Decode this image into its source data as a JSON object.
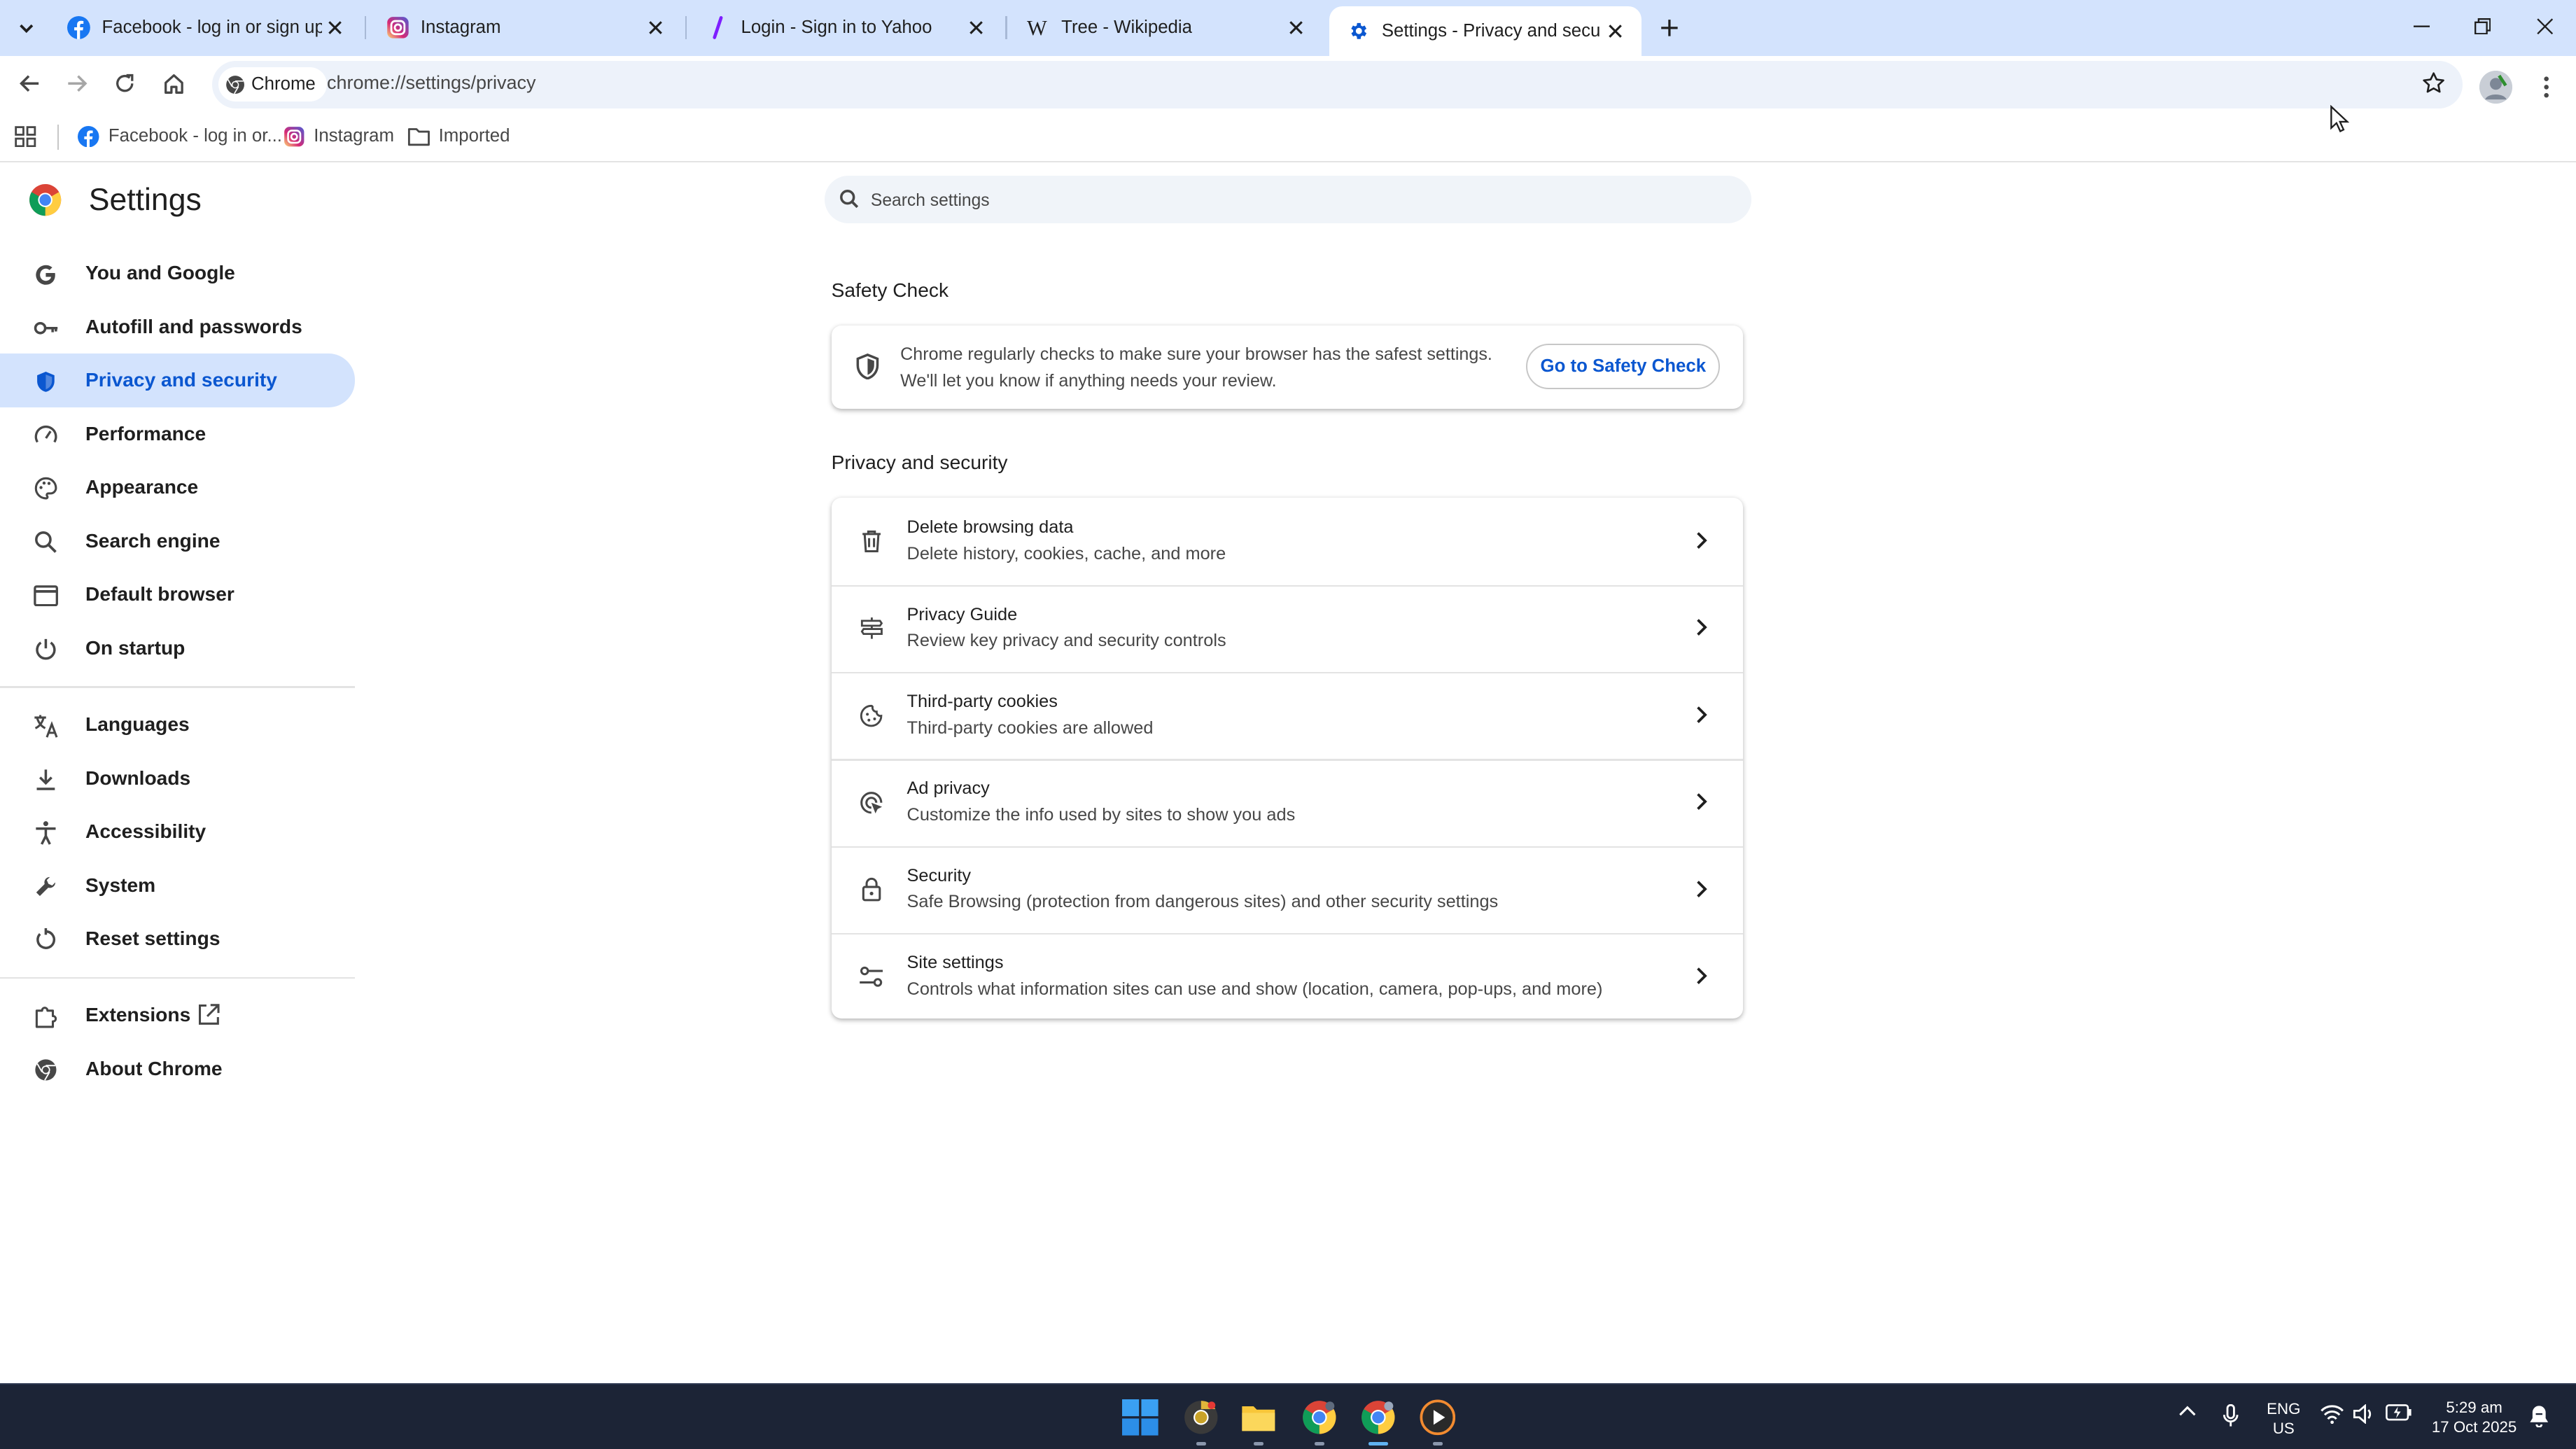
{
  "tabs": [
    {
      "title": "Facebook - log in or sign up",
      "icon": "facebook-icon",
      "active": false
    },
    {
      "title": "Instagram",
      "icon": "instagram-icon",
      "active": false
    },
    {
      "title": "Login - Sign in to Yahoo",
      "icon": "yahoo-icon",
      "active": false
    },
    {
      "title": "Tree - Wikipedia",
      "icon": "wikipedia-icon",
      "active": false
    },
    {
      "title": "Settings - Privacy and security",
      "icon": "settings-gear-icon",
      "active": true
    }
  ],
  "toolbar": {
    "chip_label": "Chrome",
    "url": "chrome://settings/privacy"
  },
  "bookmarks": [
    {
      "label": "Facebook - log in or...",
      "icon": "facebook-icon"
    },
    {
      "label": "Instagram",
      "icon": "instagram-icon"
    },
    {
      "label": "Imported",
      "icon": "folder-icon"
    }
  ],
  "settings": {
    "title": "Settings",
    "search_placeholder": "Search settings",
    "nav": [
      {
        "label": "You and Google",
        "icon": "google-icon"
      },
      {
        "label": "Autofill and passwords",
        "icon": "key-icon"
      },
      {
        "label": "Privacy and security",
        "icon": "shield-icon",
        "selected": true
      },
      {
        "label": "Performance",
        "icon": "speedometer-icon"
      },
      {
        "label": "Appearance",
        "icon": "palette-icon"
      },
      {
        "label": "Search engine",
        "icon": "search-icon"
      },
      {
        "label": "Default browser",
        "icon": "browser-window-icon"
      },
      {
        "label": "On startup",
        "icon": "power-icon"
      },
      {
        "label": "Languages",
        "icon": "translate-icon"
      },
      {
        "label": "Downloads",
        "icon": "download-icon"
      },
      {
        "label": "Accessibility",
        "icon": "accessibility-icon"
      },
      {
        "label": "System",
        "icon": "wrench-icon"
      },
      {
        "label": "Reset settings",
        "icon": "reset-icon"
      },
      {
        "label": "Extensions",
        "icon": "puzzle-icon"
      },
      {
        "label": "About Chrome",
        "icon": "chrome-icon"
      }
    ],
    "safety_check": {
      "heading": "Safety Check",
      "line1": "Chrome regularly checks to make sure your browser has the safest settings.",
      "line2": "We'll let you know if anything needs your review.",
      "button": "Go to Safety Check"
    },
    "privacy_section": {
      "heading": "Privacy and security",
      "rows": [
        {
          "title": "Delete browsing data",
          "subtitle": "Delete history, cookies, cache, and more",
          "icon": "trash-icon"
        },
        {
          "title": "Privacy Guide",
          "subtitle": "Review key privacy and security controls",
          "icon": "privacy-guide-icon"
        },
        {
          "title": "Third-party cookies",
          "subtitle": "Third-party cookies are allowed",
          "icon": "cookie-icon"
        },
        {
          "title": "Ad privacy",
          "subtitle": "Customize the info used by sites to show you ads",
          "icon": "ad-privacy-icon"
        },
        {
          "title": "Security",
          "subtitle": "Safe Browsing (protection from dangerous sites) and other security settings",
          "icon": "lock-icon"
        },
        {
          "title": "Site settings",
          "subtitle": "Controls what information sites can use and show (location, camera, pop-ups, and more)",
          "icon": "tune-icon"
        }
      ]
    }
  },
  "taskbar": {
    "language_line1": "ENG",
    "language_line2": "US",
    "time": "5:29 am",
    "date": "17 Oct 2025"
  },
  "colors": {
    "accent": "#0b57d0",
    "tabstrip": "#d3e3fd",
    "taskbar": "#1c2436"
  }
}
